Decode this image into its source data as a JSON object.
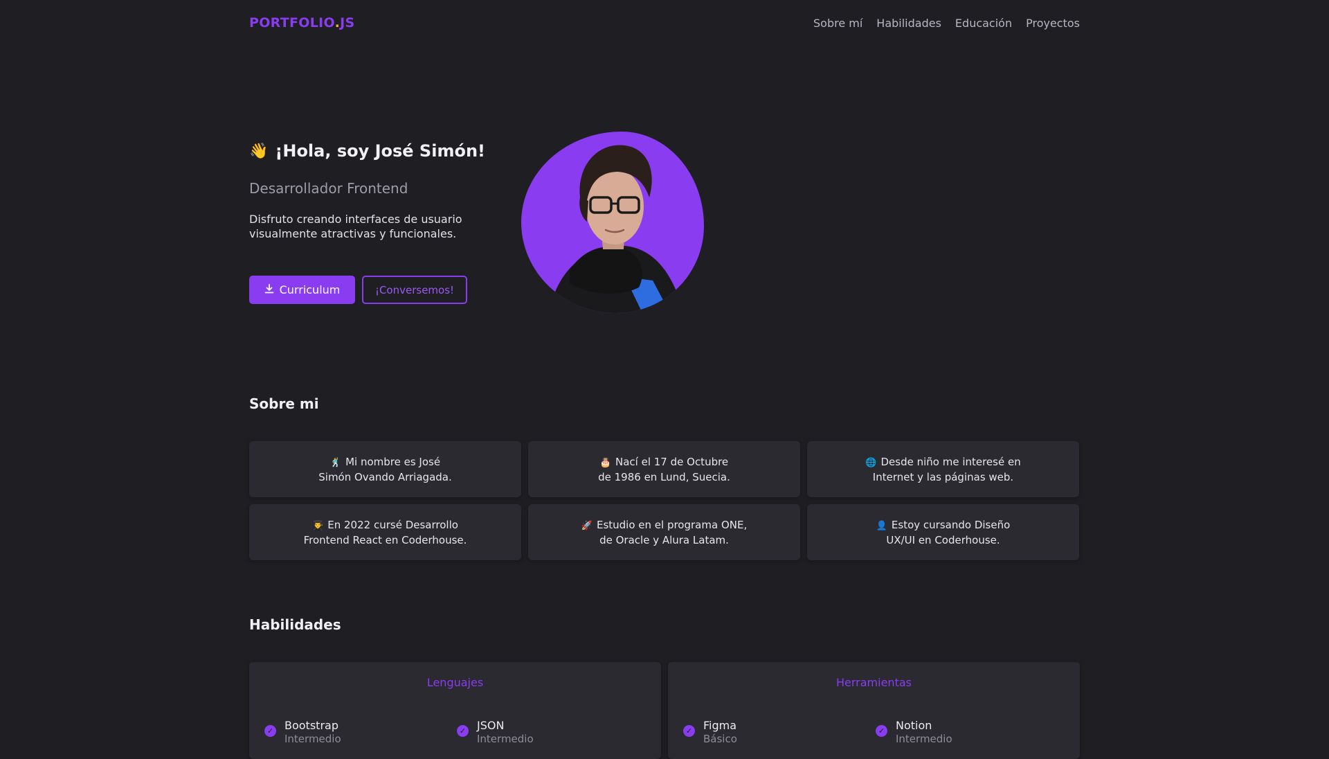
{
  "nav": {
    "logo_main": "PORTFOLIO",
    "logo_dot": ".",
    "logo_suffix": "JS",
    "links": [
      "Sobre mí",
      "Habilidades",
      "Educación",
      "Proyectos"
    ]
  },
  "hero": {
    "wave_icon": "👋",
    "title": "¡Hola, soy José Simón!",
    "subtitle": "Desarrollador Frontend",
    "description": "Disfruto creando interfaces de usuario visualmente atractivas y funcionales.",
    "cv_button": "Curriculum",
    "contact_button": "¡Conversemos!",
    "avatar_icon": "person-photo"
  },
  "about": {
    "title": "Sobre mi",
    "cards": [
      {
        "icon": "🕺",
        "line1": "Mi nombre es José",
        "line2": "Simón Ovando Arriagada."
      },
      {
        "icon": "🎂",
        "line1": "Nací el 17 de Octubre",
        "line2": "de 1986 en Lund, Suecia."
      },
      {
        "icon": "🌐",
        "line1": "Desde niño me interesé en",
        "line2": "Internet y las páginas web."
      },
      {
        "icon": "👨‍🎓",
        "line1": "En 2022 cursé Desarrollo",
        "line2": "Frontend React en Coderhouse."
      },
      {
        "icon": "🚀",
        "line1": "Estudio en el programa ONE,",
        "line2": "de Oracle y Alura Latam."
      },
      {
        "icon": "👤",
        "line1": "Estoy cursando Diseño",
        "line2": "UX/UI en Coderhouse."
      }
    ]
  },
  "skills": {
    "title": "Habilidades",
    "groups": [
      {
        "title": "Lenguajes",
        "items": [
          {
            "name": "Bootstrap",
            "level": "Intermedio"
          },
          {
            "name": "JSON",
            "level": "Intermedio"
          }
        ]
      },
      {
        "title": "Herramientas",
        "items": [
          {
            "name": "Figma",
            "level": "Básico"
          },
          {
            "name": "Notion",
            "level": "Intermedio"
          }
        ]
      }
    ]
  },
  "colors": {
    "background": "#1e1e23",
    "accent": "#8a3cf0",
    "card": "#2a2a30"
  }
}
